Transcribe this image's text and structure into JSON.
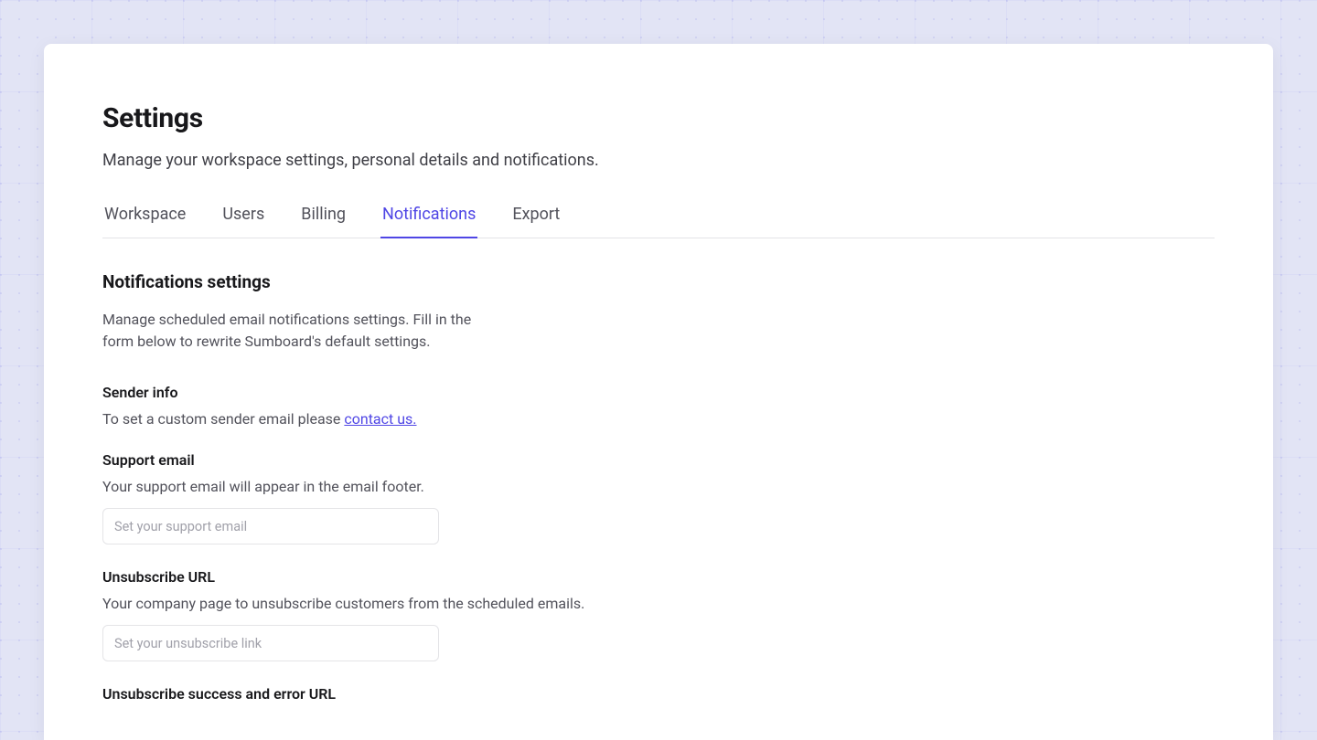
{
  "page": {
    "title": "Settings",
    "subtitle": "Manage your workspace settings, personal details and notifications."
  },
  "tabs": [
    {
      "label": "Workspace",
      "active": false
    },
    {
      "label": "Users",
      "active": false
    },
    {
      "label": "Billing",
      "active": false
    },
    {
      "label": "Notifications",
      "active": true
    },
    {
      "label": "Export",
      "active": false
    }
  ],
  "notifications": {
    "section_title": "Notifications settings",
    "section_desc": "Manage scheduled email notifications settings. Fill in the form below to rewrite Sumboard's default settings.",
    "sender_info": {
      "label": "Sender info",
      "help_prefix": "To set a custom sender email please ",
      "link_text": "contact us."
    },
    "support_email": {
      "label": "Support email",
      "help": "Your support email will appear in the email footer.",
      "placeholder": "Set your support email",
      "value": ""
    },
    "unsubscribe_url": {
      "label": "Unsubscribe URL",
      "help": "Your company page to unsubscribe customers from the scheduled emails.",
      "placeholder": "Set your unsubscribe link",
      "value": ""
    },
    "unsubscribe_result": {
      "label": "Unsubscribe success and error URL"
    }
  },
  "colors": {
    "accent": "#4f46e5",
    "text_primary": "#18181b",
    "text_secondary": "#52525b",
    "border": "#e4e4e7",
    "page_bg": "#e2e4f5",
    "card_bg": "#ffffff"
  }
}
